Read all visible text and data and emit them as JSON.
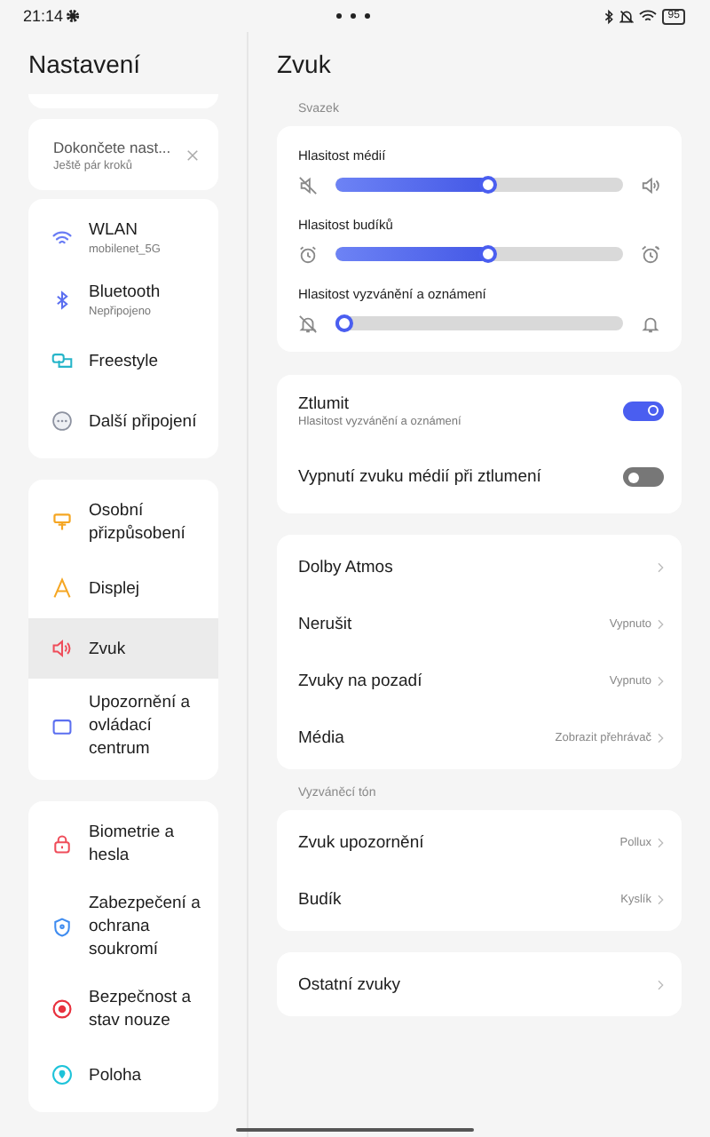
{
  "status_bar": {
    "time": "21:14",
    "battery": "95"
  },
  "sidebar": {
    "title": "Nastavení",
    "setup_card": {
      "title": "Dokončete nast...",
      "subtitle": "Ještě pár kroků"
    },
    "groups": [
      {
        "items": [
          {
            "label": "WLAN",
            "sublabel": "mobilenet_5G",
            "selected": false
          },
          {
            "label": "Bluetooth",
            "sublabel": "Nepřipojeno",
            "selected": false
          },
          {
            "label": "Freestyle",
            "selected": false
          },
          {
            "label": "Další připojení",
            "selected": false
          }
        ]
      },
      {
        "items": [
          {
            "label": "Osobní přizpůsobení",
            "selected": false
          },
          {
            "label": "Displej",
            "selected": false
          },
          {
            "label": "Zvuk",
            "selected": true
          },
          {
            "label": "Upozornění a ovládací centrum",
            "selected": false
          }
        ]
      },
      {
        "items": [
          {
            "label": "Biometrie a hesla",
            "selected": false
          },
          {
            "label": "Zabezpečení a ochrana soukromí",
            "selected": false
          },
          {
            "label": "Bezpečnost a stav nouze",
            "selected": false
          },
          {
            "label": "Poloha",
            "selected": false
          }
        ]
      }
    ]
  },
  "page": {
    "title": "Zvuk",
    "volume_header": "Svazek",
    "sliders": [
      {
        "label": "Hlasitost médií",
        "level": 0.53
      },
      {
        "label": "Hlasitost budíků",
        "level": 0.53
      },
      {
        "label": "Hlasitost vyzvánění a oznámení",
        "level": 0
      }
    ],
    "toggles": [
      {
        "label": "Ztlumit",
        "sublabel": "Hlasitost vyzvánění a oznámení",
        "on": true
      },
      {
        "label": "Vypnutí zvuku médií při ztlumení",
        "on": false
      }
    ],
    "list": [
      {
        "label": "Dolby Atmos"
      },
      {
        "label": "Nerušit",
        "value": "Vypnuto"
      },
      {
        "label": "Zvuky na pozadí",
        "value": "Vypnuto"
      },
      {
        "label": "Média",
        "value": "Zobrazit přehrávač"
      }
    ],
    "ringtone_header": "Vyzváněcí tón",
    "ringtone_list": [
      {
        "label": "Zvuk upozornění",
        "value": "Pollux"
      },
      {
        "label": "Budík",
        "value": "Kyslík"
      }
    ],
    "other_list": [
      {
        "label": "Ostatní zvuky"
      }
    ]
  }
}
